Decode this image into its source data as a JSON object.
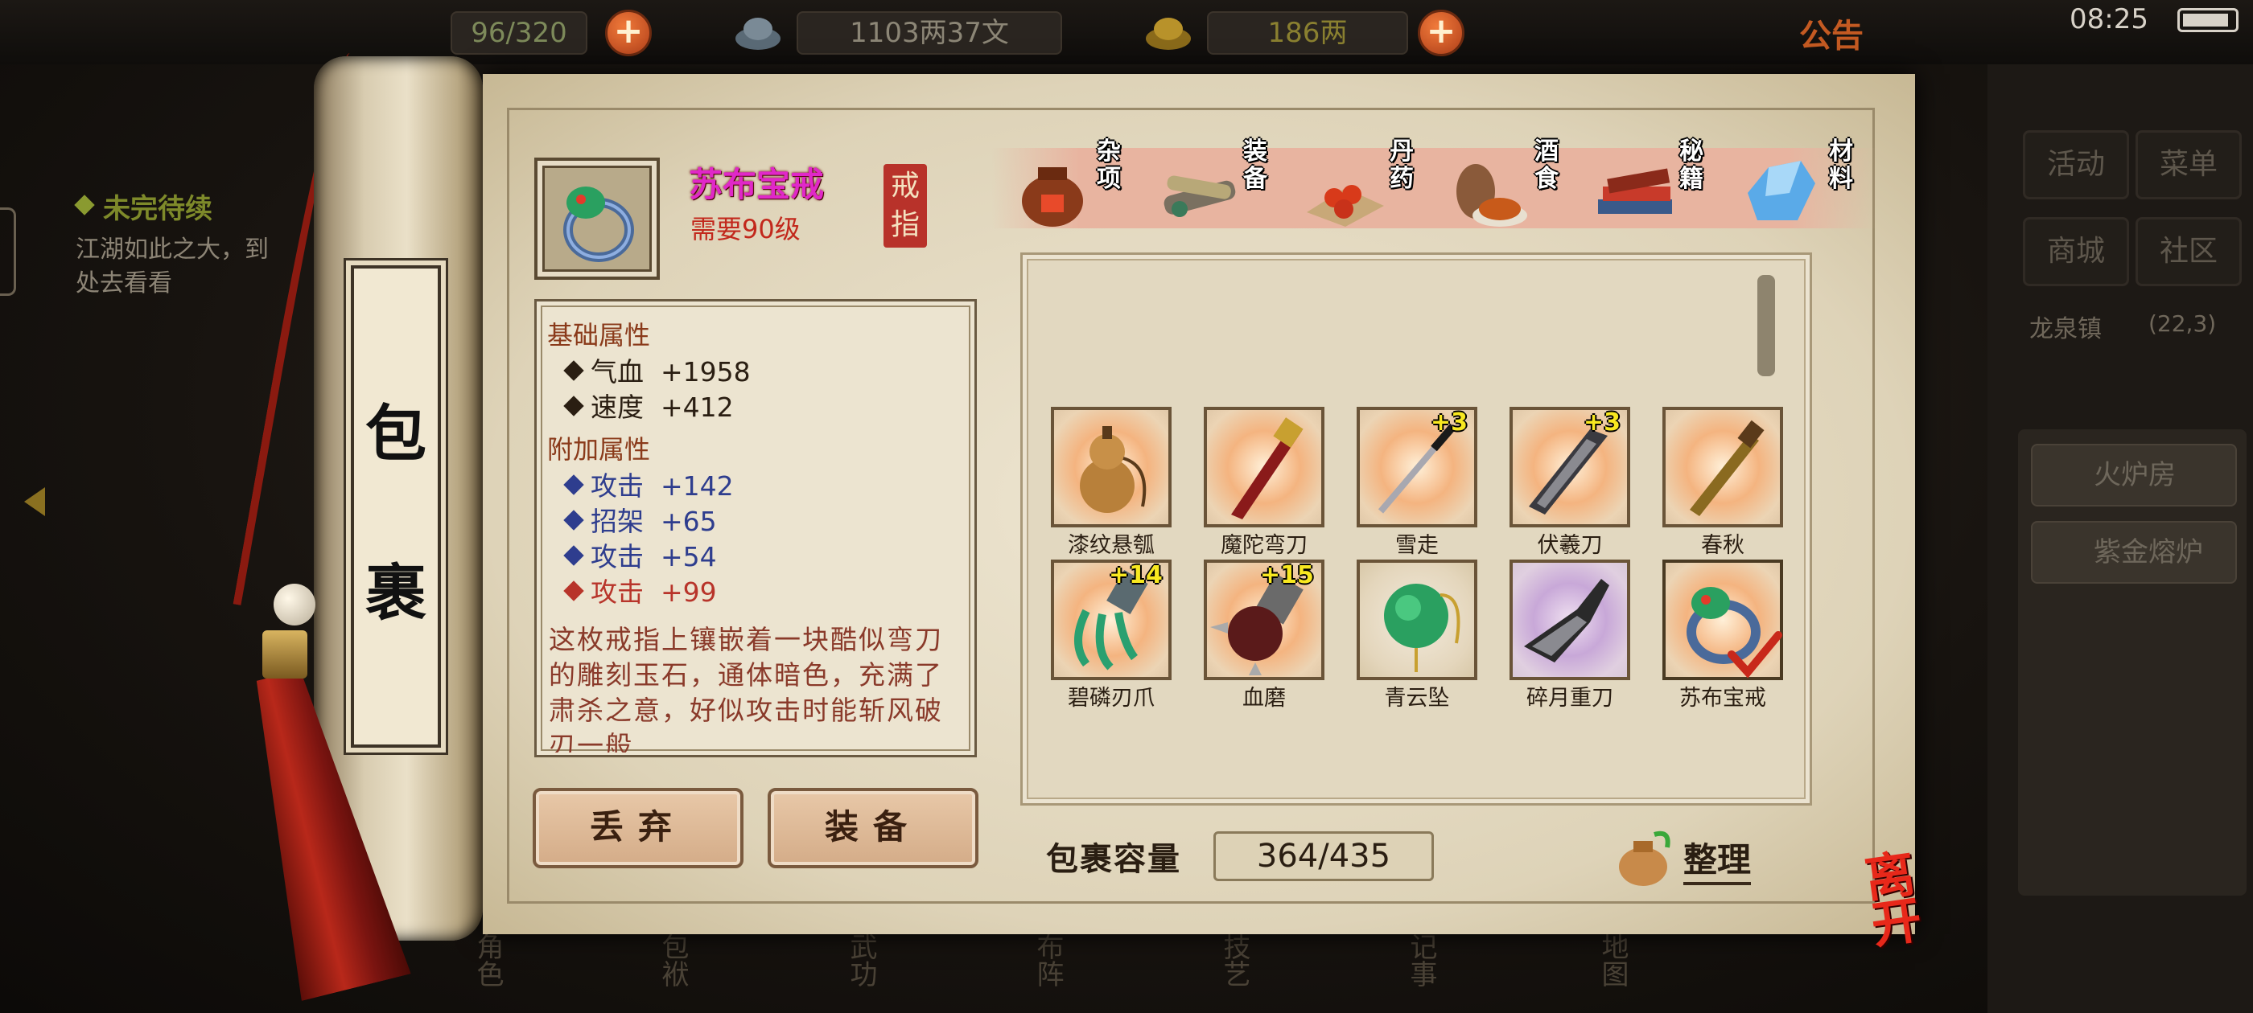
{
  "topbar": {
    "capacity_text": "96/320",
    "copper": "1103两37文",
    "gold": "186两",
    "notice_label": "公告",
    "time": "08:25"
  },
  "quest": {
    "title": "未完待续",
    "desc": "江湖如此之大，到处去看看"
  },
  "right_panel": {
    "buttons": [
      "活动",
      "菜单",
      "商城",
      "社区"
    ],
    "location": "龙泉镇",
    "coords": "(22,3)",
    "side_items": [
      "火炉房",
      "紫金熔炉"
    ]
  },
  "bottom_nav": [
    "角色",
    "包袱",
    "武功",
    "布阵",
    "技艺",
    "记事",
    "地图"
  ],
  "bag": {
    "title_chars": [
      "包",
      "裹"
    ],
    "item": {
      "name": "苏布宝戒",
      "level_req": "需要90级",
      "type_chars": [
        "戒",
        "指"
      ]
    },
    "base_header": "基础属性",
    "base_attrs": [
      {
        "name": "气血",
        "value": "+1958"
      },
      {
        "name": "速度",
        "value": "+412"
      }
    ],
    "extra_header": "附加属性",
    "extra_attrs": [
      {
        "name": "攻击",
        "value": "+142",
        "color": "#2e3d8e"
      },
      {
        "name": "招架",
        "value": "+65",
        "color": "#2e3d8e"
      },
      {
        "name": "攻击",
        "value": "+54",
        "color": "#2e3d8e"
      },
      {
        "name": "攻击",
        "value": "+99",
        "color": "#b8342a"
      }
    ],
    "description": "这枚戒指上镶嵌着一块酷似弯刀的雕刻玉石，通体暗色，充满了肃杀之意，好似攻击时能斩风破刃一般",
    "discard_label": "丢弃",
    "equip_label": "装备",
    "tabs": [
      {
        "label": "杂项",
        "icon": "wine-jar-icon"
      },
      {
        "label": "装备",
        "icon": "scroll-bundle-icon"
      },
      {
        "label": "丹药",
        "icon": "pills-icon"
      },
      {
        "label": "酒食",
        "icon": "food-icon"
      },
      {
        "label": "秘籍",
        "icon": "books-icon"
      },
      {
        "label": "材料",
        "icon": "crystal-icon"
      }
    ],
    "items": [
      {
        "name": "漆纹悬瓠",
        "plus": "",
        "icon": "gourd-icon"
      },
      {
        "name": "魔陀弯刀",
        "plus": "",
        "icon": "saber-icon"
      },
      {
        "name": "雪走",
        "plus": "+3",
        "icon": "katana-icon"
      },
      {
        "name": "伏羲刀",
        "plus": "+3",
        "icon": "broadsword-icon"
      },
      {
        "name": "春秋",
        "plus": "",
        "icon": "sword-icon"
      },
      {
        "name": "碧磷刃爪",
        "plus": "+14",
        "icon": "claw-icon"
      },
      {
        "name": "血磨",
        "plus": "+15",
        "icon": "spiked-gauntlet-icon"
      },
      {
        "name": "青云坠",
        "plus": "",
        "icon": "jade-pendant-icon"
      },
      {
        "name": "碎月重刀",
        "plus": "",
        "icon": "heavy-blade-icon"
      },
      {
        "name": "苏布宝戒",
        "plus": "",
        "icon": "ring-icon",
        "selected": true
      }
    ],
    "capacity_label": "包裹容量",
    "capacity_value": "364/435",
    "tidy_label": "整理",
    "leave_label": "离开"
  }
}
